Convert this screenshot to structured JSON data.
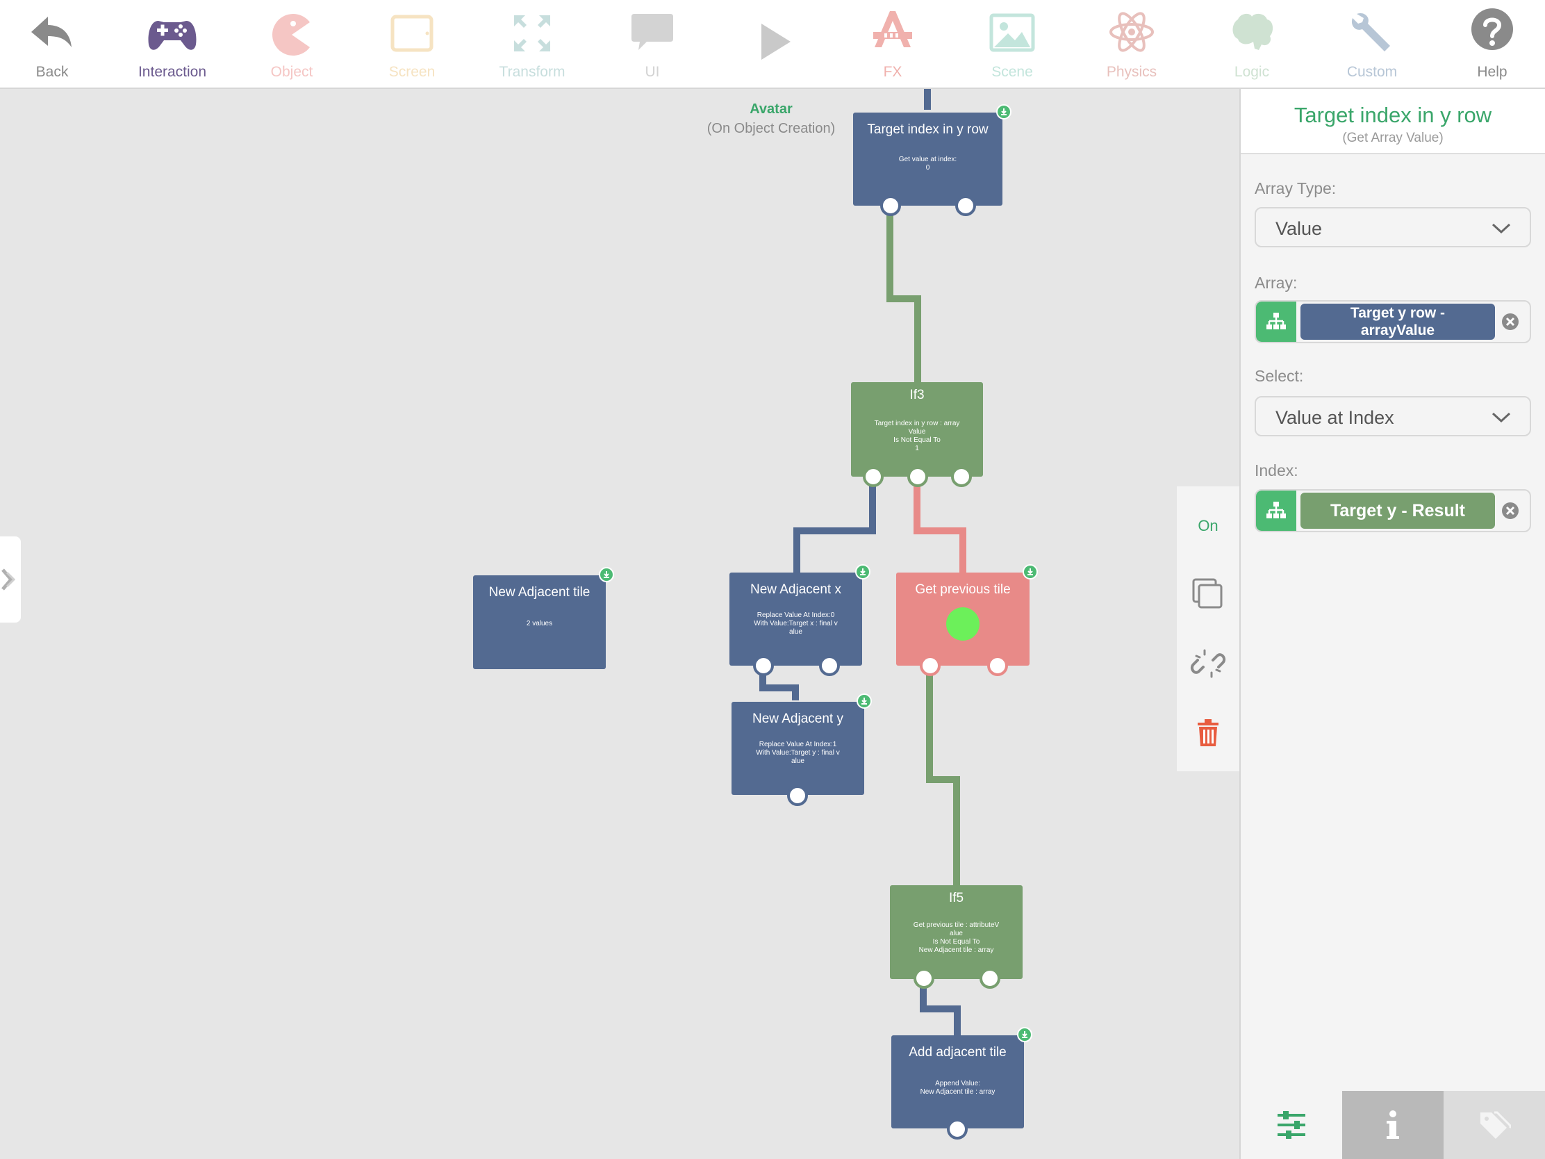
{
  "toolbar": {
    "items": [
      {
        "label": "Back",
        "icon": "back-arrow-icon",
        "color": "#8a8a8a"
      },
      {
        "label": "Interaction",
        "icon": "gamepad-icon",
        "color": "#6b5a8e",
        "selected": true
      },
      {
        "label": "Object",
        "icon": "pacman-icon",
        "color": "#f5c6c4"
      },
      {
        "label": "Screen",
        "icon": "screen-icon",
        "color": "#f6e3c2"
      },
      {
        "label": "Transform",
        "icon": "transform-icon",
        "color": "#c7dedd"
      },
      {
        "label": "UI",
        "icon": "speech-bubble-icon",
        "color": "#d3d3d3"
      },
      {
        "label": "",
        "icon": "play-icon",
        "color": "#c9c9c9"
      },
      {
        "label": "FX",
        "icon": "fx-icon",
        "color": "#f0b1ad"
      },
      {
        "label": "Scene",
        "icon": "image-icon",
        "color": "#c3e5dc"
      },
      {
        "label": "Physics",
        "icon": "atom-icon",
        "color": "#e8c0bc"
      },
      {
        "label": "Logic",
        "icon": "brain-icon",
        "color": "#cfe2d2"
      },
      {
        "label": "Custom",
        "icon": "wrench-icon",
        "color": "#b7c6d6"
      },
      {
        "label": "Help",
        "icon": "help-icon",
        "color": "#8a8a8a"
      }
    ]
  },
  "canvas": {
    "avatar": {
      "title": "Avatar",
      "subtitle": "(On Object Creation)"
    },
    "nodes": {
      "target_index": {
        "title": "Target index in y row",
        "desc": "Get value at index:\n0"
      },
      "if3": {
        "title": "If3",
        "desc": "Target index in y row : array\nValue\nIs Not Equal To\n1"
      },
      "new_adjacent_tile": {
        "title": "New Adjacent tile",
        "desc": "2 values"
      },
      "new_adjacent_x": {
        "title": "New Adjacent x",
        "desc": "Replace Value At Index:0\nWith Value:Target x : final v\nalue"
      },
      "get_previous_tile": {
        "title": "Get previous tile",
        "desc": ""
      },
      "new_adjacent_y": {
        "title": "New Adjacent y",
        "desc": "Replace Value At Index:1\nWith Value:Target y : final v\nalue"
      },
      "if5": {
        "title": "If5",
        "desc": "Get previous tile : attributeV\nalue\nIs Not Equal To\nNew Adjacent tile : array"
      },
      "add_adjacent_tile": {
        "title": "Add adjacent tile",
        "desc": "Append Value:\nNew Adjacent tile : array"
      }
    },
    "colors": {
      "blue": "#536a91",
      "green": "#789f6f",
      "red": "#e88a88",
      "wire_green": "#789f6f",
      "wire_blue": "#536a91",
      "wire_red": "#e88a88"
    }
  },
  "actionbar": {
    "on_label": "On",
    "buttons": [
      "duplicate-icon",
      "unlink-icon",
      "trash-icon"
    ]
  },
  "panel": {
    "title": "Target index in y row",
    "subtitle": "(Get Array Value)",
    "array_type": {
      "label": "Array Type:",
      "value": "Value"
    },
    "array": {
      "label": "Array:",
      "value": "Target y row -\narrayValue"
    },
    "select": {
      "label": "Select:",
      "value": "Value at Index"
    },
    "index": {
      "label": "Index:",
      "value": "Target y - Result"
    },
    "tabs": [
      "sliders-icon",
      "info-icon",
      "tag-icon"
    ],
    "accent": "#3aa66a"
  }
}
